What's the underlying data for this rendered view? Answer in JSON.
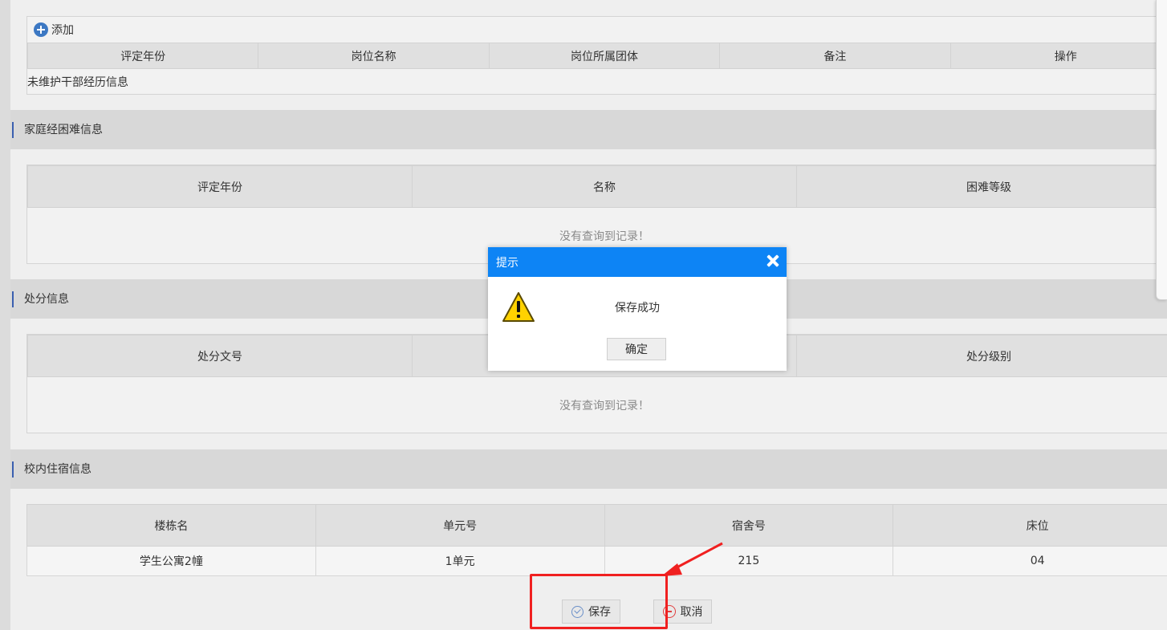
{
  "cadre": {
    "add_label": "添加",
    "columns": [
      "评定年份",
      "岗位名称",
      "岗位所属团体",
      "备注",
      "操作"
    ],
    "empty_text": "未维护干部经历信息"
  },
  "family_hardship": {
    "title": "家庭经困难信息",
    "columns": [
      "评定年份",
      "名称",
      "困难等级"
    ],
    "empty_text": "没有查询到记录！"
  },
  "discipline": {
    "title": "处分信息",
    "columns": [
      "处分文号",
      "",
      "处分级别"
    ],
    "empty_text": "没有查询到记录！"
  },
  "dorm": {
    "title": "校内住宿信息",
    "columns": [
      "楼栋名",
      "单元号",
      "宿舍号",
      "床位"
    ],
    "rows": [
      [
        "学生公寓2幢",
        "1单元",
        "215",
        "04"
      ]
    ]
  },
  "buttons": {
    "save": "保存",
    "cancel": "取消"
  },
  "modal": {
    "title": "提示",
    "message": "保存成功",
    "ok": "确定"
  },
  "colors": {
    "modal_header": "#0d84f5",
    "section_accent": "#3a5fb0",
    "annotation": "#f02020"
  }
}
